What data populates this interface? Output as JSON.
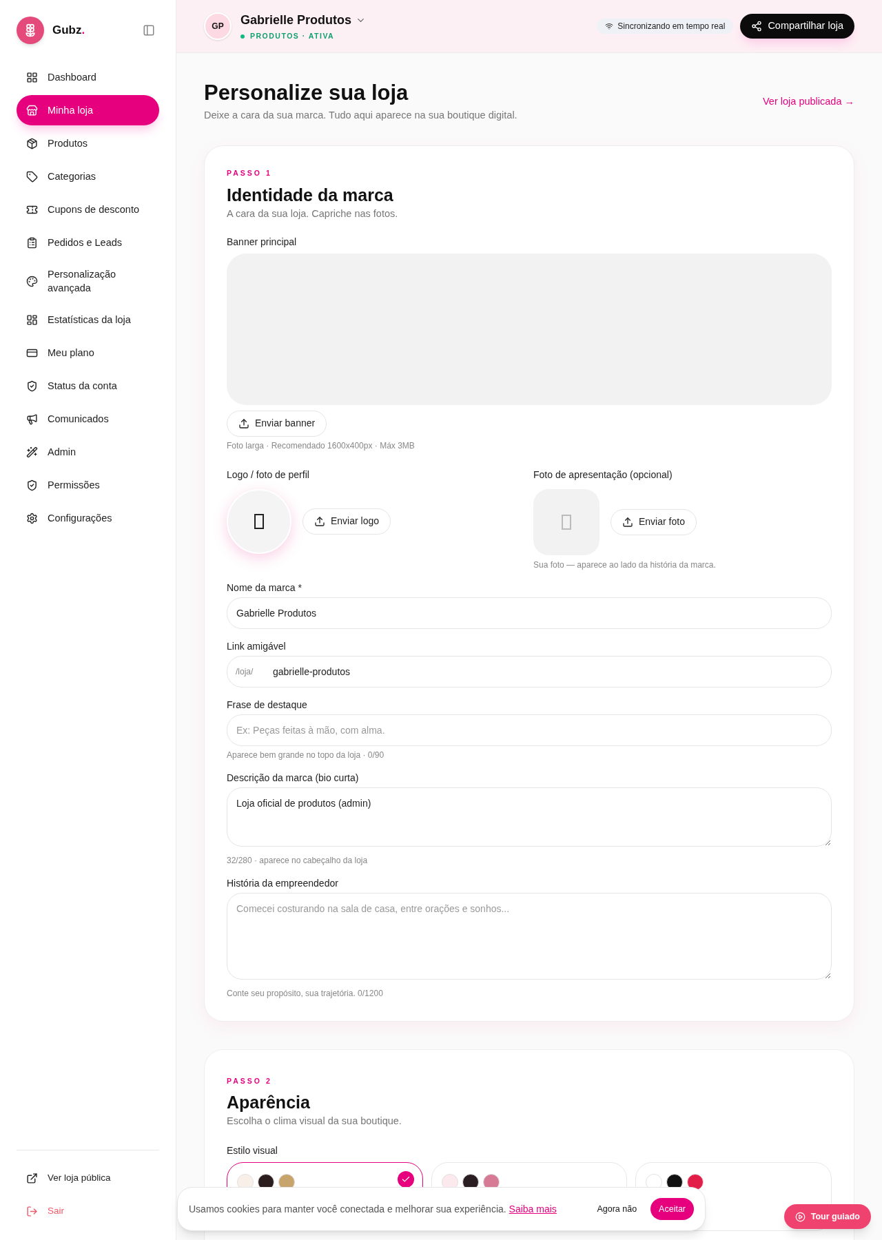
{
  "brand": {
    "name": "Gubz",
    "dot": "."
  },
  "sidebar": {
    "items": [
      {
        "label": "Dashboard",
        "selected": false
      },
      {
        "label": "Minha loja",
        "selected": true
      },
      {
        "label": "Produtos",
        "selected": false
      },
      {
        "label": "Categorias",
        "selected": false
      },
      {
        "label": "Cupons de desconto",
        "selected": false
      },
      {
        "label": "Pedidos e Leads",
        "selected": false
      },
      {
        "label": "Personalização avançada",
        "selected": false
      },
      {
        "label": "Estatísticas da loja",
        "selected": false
      },
      {
        "label": "Meu plano",
        "selected": false
      },
      {
        "label": "Status da conta",
        "selected": false
      },
      {
        "label": "Comunicados",
        "selected": false
      },
      {
        "label": "Admin",
        "selected": false
      },
      {
        "label": "Permissões",
        "selected": false
      },
      {
        "label": "Configurações",
        "selected": false
      }
    ],
    "footer": [
      {
        "label": "Ver loja pública",
        "kind": "link"
      },
      {
        "label": "Sair",
        "kind": "logout"
      }
    ]
  },
  "header": {
    "initials": "GP",
    "store": "Gabrielle Produtos",
    "status": "PRODUTOS · ATIVA",
    "sync": "Sincronizando em tempo real",
    "share": "Compartilhar loja"
  },
  "page": {
    "title": "Personalize sua loja",
    "subtitle": "Deixe a cara da sua marca. Tudo aqui aparece na sua boutique digital.",
    "link": "Ver loja publicada →"
  },
  "step1": {
    "step": "PASSO 1",
    "title": "Identidade da marca",
    "subtitle": "A cara da sua loja. Capriche nas fotos.",
    "banner": {
      "label": "Banner principal",
      "button": "Enviar banner",
      "hint": "Foto larga · Recomendado 1600x400px · Máx 3MB"
    },
    "logo": {
      "label": "Logo / foto de perfil",
      "button": "Enviar logo"
    },
    "photo": {
      "label": "Foto de apresentação (opcional)",
      "button": "Enviar foto",
      "hint": "Sua foto — aparece ao lado da história da marca."
    },
    "fields": [
      {
        "kind": "input",
        "label": "Nome da marca *",
        "value": "Gabrielle Produtos"
      },
      {
        "kind": "prefixed",
        "label": "Link amigável",
        "prefix": "/loja/",
        "value": "gabrielle-produtos"
      },
      {
        "kind": "input",
        "label": "Frase de destaque",
        "placeholder": "Ex: Peças feitas à mão, com alma.",
        "hint": "Aparece bem grande no topo da loja · 0/90"
      },
      {
        "kind": "textarea",
        "label": "Descrição da marca (bio curta)",
        "value": "Loja oficial de produtos (admin)",
        "hint": "32/280 · aparece no cabeçalho da loja"
      },
      {
        "kind": "textarea_tall",
        "label": "História da empreendedor",
        "placeholder": "Comecei costurando na sala de casa, entre orações e sonhos...",
        "hint": "Conte seu propósito, sua trajetória. 0/1200"
      }
    ]
  },
  "step2": {
    "step": "PASSO 2",
    "title": "Aparência",
    "subtitle": "Escolha o clima visual da sua boutique.",
    "label": "Estilo visual",
    "styles": [
      {
        "selected": true,
        "swatches": [
          {
            "color": "#f7efe8"
          },
          {
            "color": "#2b1d1d"
          },
          {
            "color": "#c7a46b"
          }
        ]
      },
      {
        "selected": false,
        "swatches": [
          {
            "color": "#fbe9ee"
          },
          {
            "color": "#2a1e22"
          },
          {
            "color": "#d77a95"
          }
        ]
      },
      {
        "selected": false,
        "swatches": [
          {
            "color": "#ffffff"
          },
          {
            "color": "#111111"
          },
          {
            "color": "#e11d48"
          }
        ]
      }
    ]
  },
  "cookie": {
    "text": "Usamos cookies para manter você conectada e melhorar sua experiência.",
    "link": "Saiba mais",
    "decline": "Agora não",
    "accept": "Aceitar"
  },
  "tour": "Tour guiado"
}
